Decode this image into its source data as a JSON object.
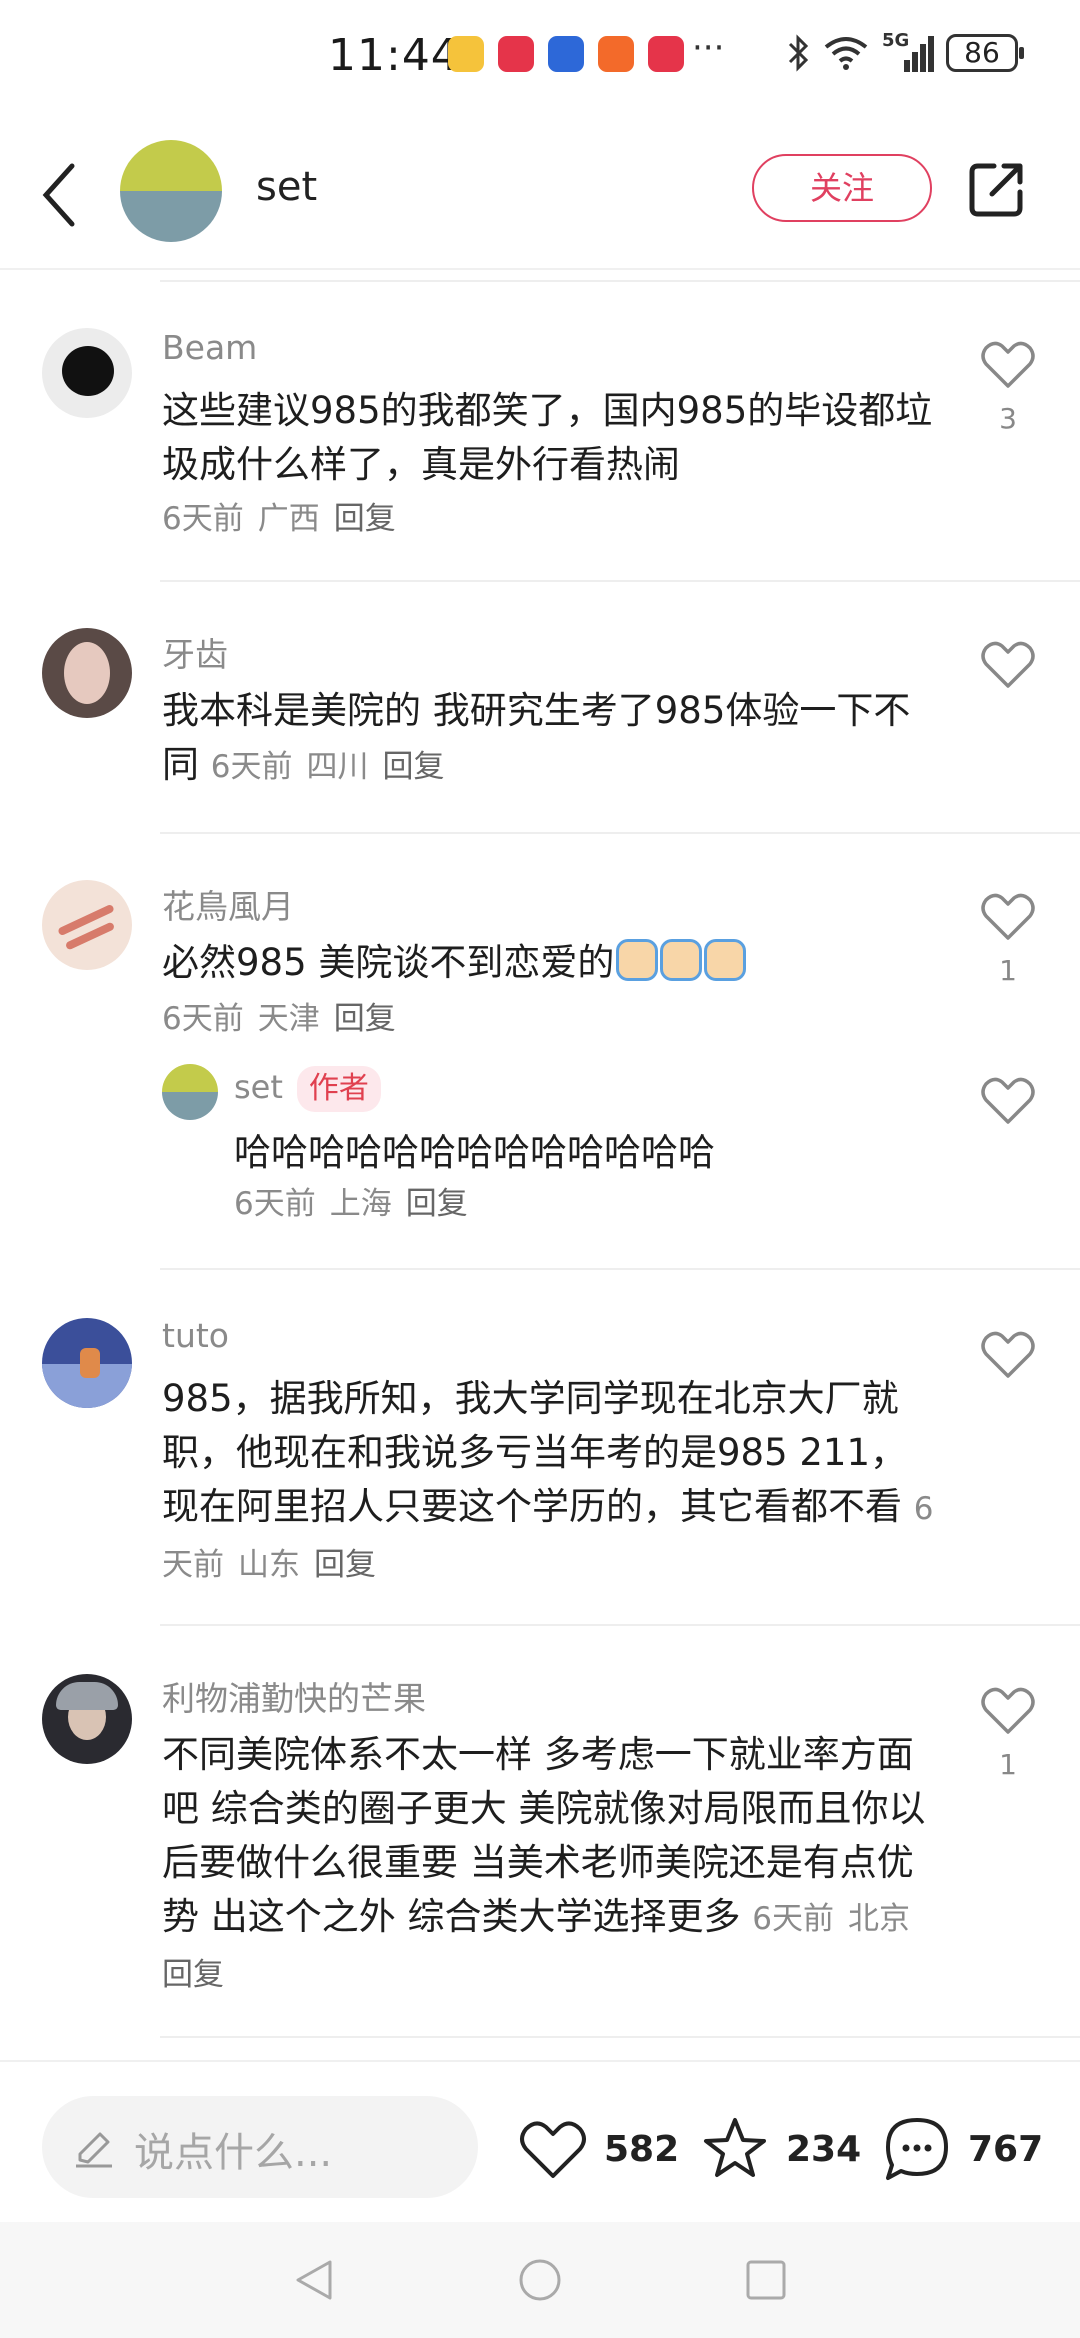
{
  "status_bar": {
    "time": "11:44",
    "more": "···",
    "network": "5G",
    "battery": "86"
  },
  "header": {
    "author_name": "set",
    "follow_label": "关注"
  },
  "comments": [
    {
      "name": "Beam",
      "text": "这些建议985的我都笑了，国内985的毕设都垃圾成什么样了，真是外行看热闹",
      "time": "6天前",
      "location": "广西",
      "reply": "回复",
      "likes": "3"
    },
    {
      "name": "牙齿",
      "text": "我本科是美院的 我研究生考了985体验一下不同",
      "time": "6天前",
      "location": "四川",
      "reply": "回复",
      "likes": ""
    },
    {
      "name": "花鳥風月",
      "text": "必然985 美院谈不到恋爱的",
      "time": "6天前",
      "location": "天津",
      "reply": "回复",
      "likes": "1",
      "reply_item": {
        "name": "set",
        "tag": "作者",
        "text": "哈哈哈哈哈哈哈哈哈哈哈哈哈",
        "time": "6天前",
        "location": "上海",
        "reply": "回复"
      }
    },
    {
      "name": "tuto",
      "text": "985，据我所知，我大学同学现在北京大厂就职，他现在和我说多亏当年考的是985 211，现在阿里招人只要这个学历的，其它看都不看",
      "time": "6天前",
      "location": "山东",
      "reply": "回复",
      "likes": ""
    },
    {
      "name": "利物浦勤快的芒果",
      "text": "不同美院体系不太一样 多考虑一下就业率方面吧 综合类的圈子更大 美院就像对局限而且你以后要做什么很重要 当美术老师美院还是有点优势 出这个之外 综合类大学选择更多",
      "time": "6天前",
      "location": "北京",
      "reply": "回复",
      "likes": "1"
    }
  ],
  "bottom_bar": {
    "input_placeholder": "说点什么...",
    "likes": "582",
    "favorites": "234",
    "comments": "767"
  }
}
